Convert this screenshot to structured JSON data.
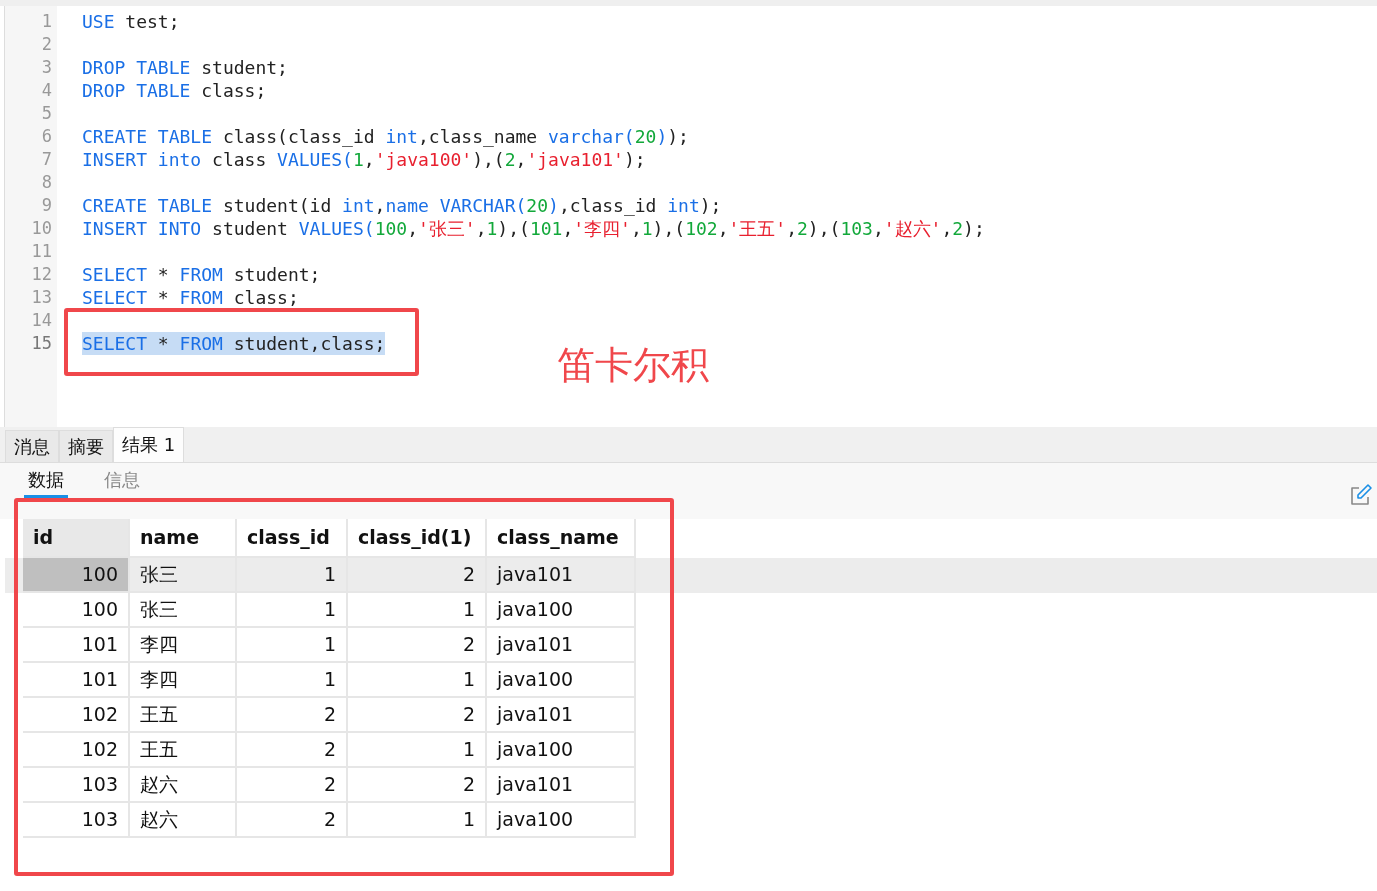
{
  "editor": {
    "lines": [
      {
        "number": "1",
        "selected": false,
        "tokens": [
          {
            "kind": "keyword",
            "text": "USE"
          },
          {
            "kind": "plain",
            "text": " test;"
          }
        ]
      },
      {
        "number": "2",
        "selected": false
      },
      {
        "number": "3",
        "selected": false,
        "tokens": [
          {
            "kind": "keyword",
            "text": "DROP TABLE"
          },
          {
            "kind": "plain",
            "text": " student;"
          }
        ]
      },
      {
        "number": "4",
        "selected": false,
        "tokens": [
          {
            "kind": "keyword",
            "text": "DROP TABLE"
          },
          {
            "kind": "plain",
            "text": " class;"
          }
        ]
      },
      {
        "number": "5",
        "selected": false
      },
      {
        "number": "6",
        "selected": false,
        "tokens": [
          {
            "kind": "keyword",
            "text": "CREATE TABLE"
          },
          {
            "kind": "plain",
            "text": " class(class_id "
          },
          {
            "kind": "keyword",
            "text": "int"
          },
          {
            "kind": "plain",
            "text": ",class_name "
          },
          {
            "kind": "keyword",
            "text": "varchar("
          },
          {
            "kind": "number",
            "text": "20"
          },
          {
            "kind": "keyword",
            "text": ")"
          },
          {
            "kind": "plain",
            "text": ");"
          }
        ]
      },
      {
        "number": "7",
        "selected": false,
        "tokens": [
          {
            "kind": "keyword",
            "text": "INSERT into"
          },
          {
            "kind": "plain",
            "text": " class "
          },
          {
            "kind": "keyword",
            "text": "VALUES("
          },
          {
            "kind": "number",
            "text": "1"
          },
          {
            "kind": "plain",
            "text": ","
          },
          {
            "kind": "string",
            "text": "'java100'"
          },
          {
            "kind": "plain",
            "text": "),("
          },
          {
            "kind": "number",
            "text": "2"
          },
          {
            "kind": "plain",
            "text": ","
          },
          {
            "kind": "string",
            "text": "'java101'"
          },
          {
            "kind": "plain",
            "text": ");"
          }
        ]
      },
      {
        "number": "8",
        "selected": false
      },
      {
        "number": "9",
        "selected": false,
        "tokens": [
          {
            "kind": "keyword",
            "text": "CREATE TABLE"
          },
          {
            "kind": "plain",
            "text": " student(id "
          },
          {
            "kind": "keyword",
            "text": "int"
          },
          {
            "kind": "plain",
            "text": ","
          },
          {
            "kind": "keyword",
            "text": "name VARCHAR("
          },
          {
            "kind": "number",
            "text": "20"
          },
          {
            "kind": "keyword",
            "text": ")"
          },
          {
            "kind": "plain",
            "text": ",class_id "
          },
          {
            "kind": "keyword",
            "text": "int"
          },
          {
            "kind": "plain",
            "text": ");"
          }
        ]
      },
      {
        "number": "10",
        "selected": false,
        "tokens": [
          {
            "kind": "keyword",
            "text": "INSERT INTO"
          },
          {
            "kind": "plain",
            "text": " student "
          },
          {
            "kind": "keyword",
            "text": "VALUES("
          },
          {
            "kind": "number",
            "text": "100"
          },
          {
            "kind": "plain",
            "text": ","
          },
          {
            "kind": "string",
            "text": "'张三'"
          },
          {
            "kind": "plain",
            "text": ","
          },
          {
            "kind": "number",
            "text": "1"
          },
          {
            "kind": "plain",
            "text": "),("
          },
          {
            "kind": "number",
            "text": "101"
          },
          {
            "kind": "plain",
            "text": ","
          },
          {
            "kind": "string",
            "text": "'李四'"
          },
          {
            "kind": "plain",
            "text": ","
          },
          {
            "kind": "number",
            "text": "1"
          },
          {
            "kind": "plain",
            "text": "),("
          },
          {
            "kind": "number",
            "text": "102"
          },
          {
            "kind": "plain",
            "text": ","
          },
          {
            "kind": "string",
            "text": "'王五'"
          },
          {
            "kind": "plain",
            "text": ","
          },
          {
            "kind": "number",
            "text": "2"
          },
          {
            "kind": "plain",
            "text": "),("
          },
          {
            "kind": "number",
            "text": "103"
          },
          {
            "kind": "plain",
            "text": ","
          },
          {
            "kind": "string",
            "text": "'赵六'"
          },
          {
            "kind": "plain",
            "text": ","
          },
          {
            "kind": "number",
            "text": "2"
          },
          {
            "kind": "plain",
            "text": ");"
          }
        ]
      },
      {
        "number": "11",
        "selected": false
      },
      {
        "number": "12",
        "selected": false,
        "tokens": [
          {
            "kind": "keyword",
            "text": "SELECT"
          },
          {
            "kind": "plain",
            "text": " * "
          },
          {
            "kind": "keyword",
            "text": "FROM"
          },
          {
            "kind": "plain",
            "text": " student;"
          }
        ]
      },
      {
        "number": "13",
        "selected": false,
        "tokens": [
          {
            "kind": "keyword",
            "text": "SELECT"
          },
          {
            "kind": "plain",
            "text": " * "
          },
          {
            "kind": "keyword",
            "text": "FROM"
          },
          {
            "kind": "plain",
            "text": " class;"
          }
        ]
      },
      {
        "number": "14",
        "selected": false
      },
      {
        "number": "15",
        "selected": true,
        "tokens": [
          {
            "kind": "keyword",
            "text": "SELECT"
          },
          {
            "kind": "plain",
            "text": " * "
          },
          {
            "kind": "keyword",
            "text": "FROM"
          },
          {
            "kind": "plain",
            "text": " student,class;"
          }
        ]
      }
    ]
  },
  "result_tabs": [
    {
      "label": "消息",
      "selected": false
    },
    {
      "label": "摘要",
      "selected": false
    },
    {
      "label": "结果 1",
      "selected": true
    }
  ],
  "view_tabs": [
    {
      "label": "数据",
      "selected": true
    },
    {
      "label": "信息",
      "selected": false
    }
  ],
  "table": {
    "columns": [
      "id",
      "name",
      "class_id",
      "class_id(1)",
      "class_name"
    ],
    "rows": [
      {
        "selected": true,
        "cells": [
          "100",
          "张三",
          "1",
          "2",
          "java101"
        ]
      },
      {
        "selected": false,
        "cells": [
          "100",
          "张三",
          "1",
          "1",
          "java100"
        ]
      },
      {
        "selected": false,
        "cells": [
          "101",
          "李四",
          "1",
          "2",
          "java101"
        ]
      },
      {
        "selected": false,
        "cells": [
          "101",
          "李四",
          "1",
          "1",
          "java100"
        ]
      },
      {
        "selected": false,
        "cells": [
          "102",
          "王五",
          "2",
          "2",
          "java101"
        ]
      },
      {
        "selected": false,
        "cells": [
          "102",
          "王五",
          "2",
          "1",
          "java100"
        ]
      },
      {
        "selected": false,
        "cells": [
          "103",
          "赵六",
          "2",
          "2",
          "java101"
        ]
      },
      {
        "selected": false,
        "cells": [
          "103",
          "赵六",
          "2",
          "1",
          "java100"
        ]
      }
    ]
  },
  "annotations": [
    {
      "kind": "frame"
    },
    {
      "kind": "frame"
    },
    {
      "kind": "label",
      "text": "笛卡尔积"
    }
  ]
}
